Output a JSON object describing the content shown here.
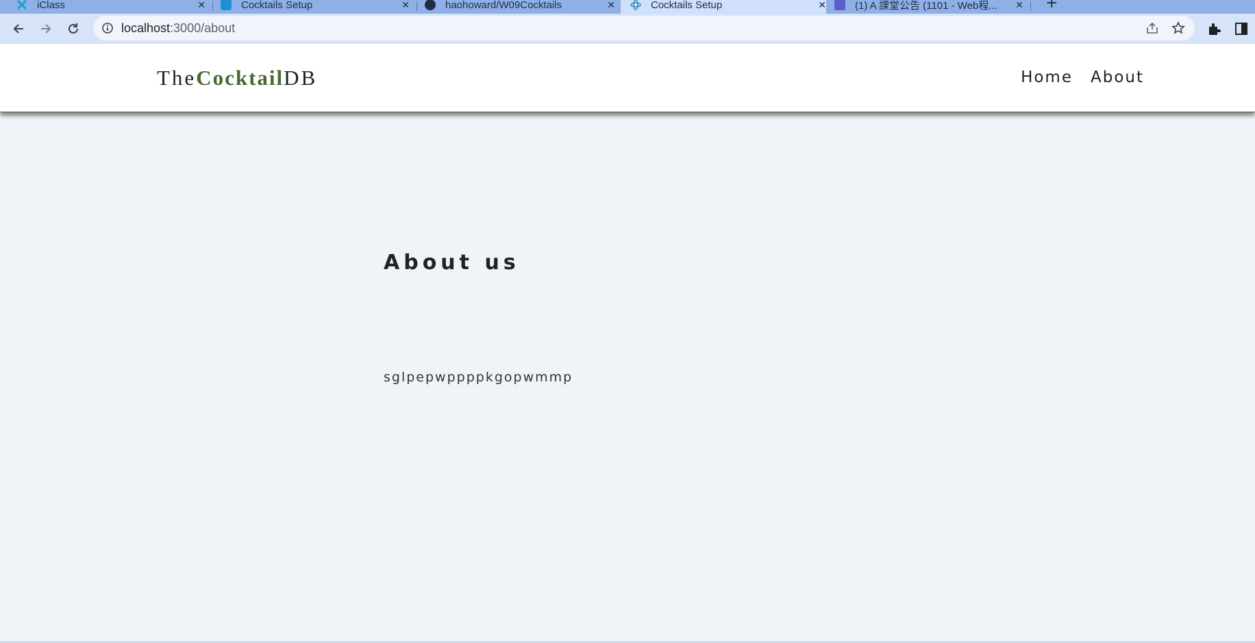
{
  "browser": {
    "tabs": [
      {
        "title": "iClass",
        "favicon": "iclass-icon",
        "active": false
      },
      {
        "title": "Cocktails Setup",
        "favicon": "codesandbox-icon",
        "active": false
      },
      {
        "title": "haohoward/W09Cocktails",
        "favicon": "github-icon",
        "active": false
      },
      {
        "title": "Cocktails Setup",
        "favicon": "react-icon",
        "active": true
      },
      {
        "title": "(1) A 課堂公告 (1101 - Web程...",
        "favicon": "teams-icon",
        "active": false
      }
    ],
    "new_tab_label": "+",
    "url_host": "localhost",
    "url_path": ":3000/about"
  },
  "navbar": {
    "logo_prefix": "The",
    "logo_highlight": "Cocktail",
    "logo_suffix": "DB",
    "links": [
      {
        "label": "Home"
      },
      {
        "label": "About"
      }
    ]
  },
  "about": {
    "title": "About us",
    "text": "sglpepwppppkgopwmmp"
  },
  "colors": {
    "brand_green": "#476a2e",
    "page_background": "#f0f4f8",
    "tabstrip": "#8fb0e6",
    "toolbar": "#d6e3f8"
  }
}
